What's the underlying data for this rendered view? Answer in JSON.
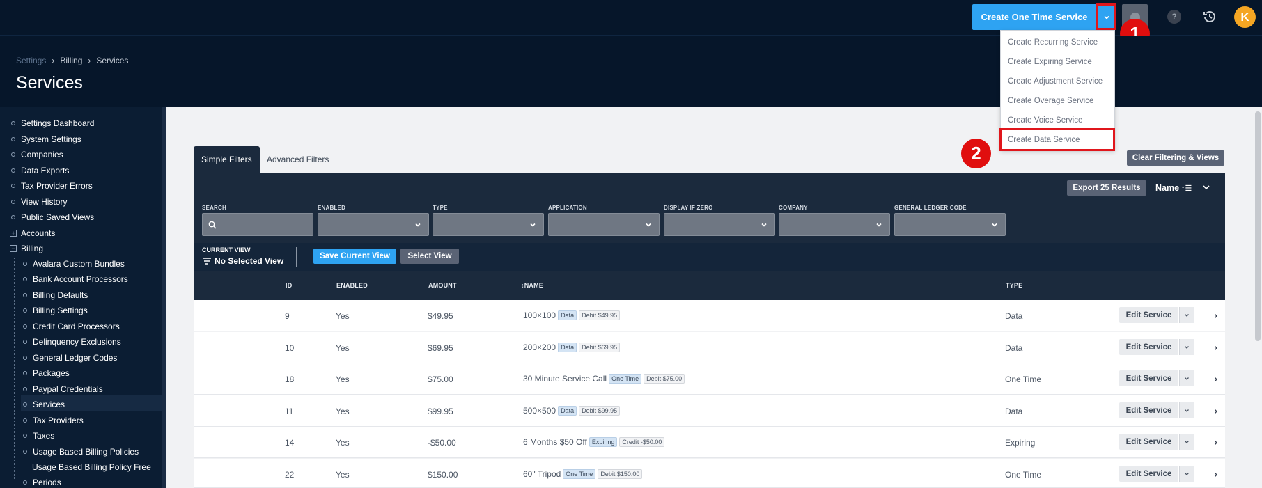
{
  "topbar": {
    "primary_button": "Create One Time Service",
    "help_label": "?",
    "avatar_initial": "K",
    "accent_color": "#2ea3f2"
  },
  "dropdown": {
    "items": [
      "Create Recurring Service",
      "Create Expiring Service",
      "Create Adjustment Service",
      "Create Overage Service",
      "Create Voice Service",
      "Create Data Service"
    ]
  },
  "markers": [
    "1",
    "2"
  ],
  "header": {
    "breadcrumb": [
      "Settings",
      "Billing",
      "Services"
    ],
    "separator": "›",
    "title": "Services"
  },
  "sidebar": {
    "top_items": [
      "Settings Dashboard",
      "System Settings",
      "Companies",
      "Data Exports",
      "Tax Provider Errors",
      "View History",
      "Public Saved Views"
    ],
    "accounts": "Accounts",
    "billing": "Billing",
    "billing_children": [
      "Avalara Custom Bundles",
      "Bank Account Processors",
      "Billing Defaults",
      "Billing Settings",
      "Credit Card Processors",
      "Delinquency Exclusions",
      "General Ledger Codes",
      "Packages",
      "Paypal Credentials",
      "Services",
      "Tax Providers",
      "Taxes",
      "Usage Based Billing Policies"
    ],
    "last_item_line1": "Usage Based Billing Policy Free",
    "last_item_line2": "Periods",
    "active_item": "Services"
  },
  "filters": {
    "tabs": [
      "Simple Filters",
      "Advanced Filters"
    ],
    "clear_button": "Clear Filtering & Views",
    "export_button": "Export 25 Results",
    "sort_label": "Name",
    "fields": [
      "SEARCH",
      "ENABLED",
      "TYPE",
      "APPLICATION",
      "DISPLAY IF ZERO",
      "COMPANY",
      "GENERAL LEDGER CODE"
    ],
    "current_view_label": "CURRENT VIEW",
    "current_view_value": "No Selected View",
    "save_view_button": "Save Current View",
    "select_view_button": "Select View"
  },
  "table": {
    "columns": [
      "ID",
      "ENABLED",
      "AMOUNT",
      "NAME",
      "TYPE"
    ],
    "sort_indicator": "↕",
    "edit_label": "Edit Service",
    "rows": [
      {
        "id": "9",
        "enabled": "Yes",
        "amount": "$49.95",
        "name": "100×100",
        "tag1": "Data",
        "tag2": "Debit $49.95",
        "type": "Data"
      },
      {
        "id": "10",
        "enabled": "Yes",
        "amount": "$69.95",
        "name": "200×200",
        "tag1": "Data",
        "tag2": "Debit $69.95",
        "type": "Data"
      },
      {
        "id": "18",
        "enabled": "Yes",
        "amount": "$75.00",
        "name": "30 Minute Service Call",
        "tag1": "One Time",
        "tag2": "Debit $75.00",
        "type": "One Time"
      },
      {
        "id": "11",
        "enabled": "Yes",
        "amount": "$99.95",
        "name": "500×500",
        "tag1": "Data",
        "tag2": "Debit $99.95",
        "type": "Data"
      },
      {
        "id": "14",
        "enabled": "Yes",
        "amount": "-$50.00",
        "name": "6 Months $50 Off",
        "tag1": "Expiring",
        "tag2": "Credit -$50.00",
        "type": "Expiring"
      },
      {
        "id": "22",
        "enabled": "Yes",
        "amount": "$150.00",
        "name": "60\" Tripod",
        "tag1": "One Time",
        "tag2": "Debit $150.00",
        "type": "One Time"
      }
    ]
  }
}
